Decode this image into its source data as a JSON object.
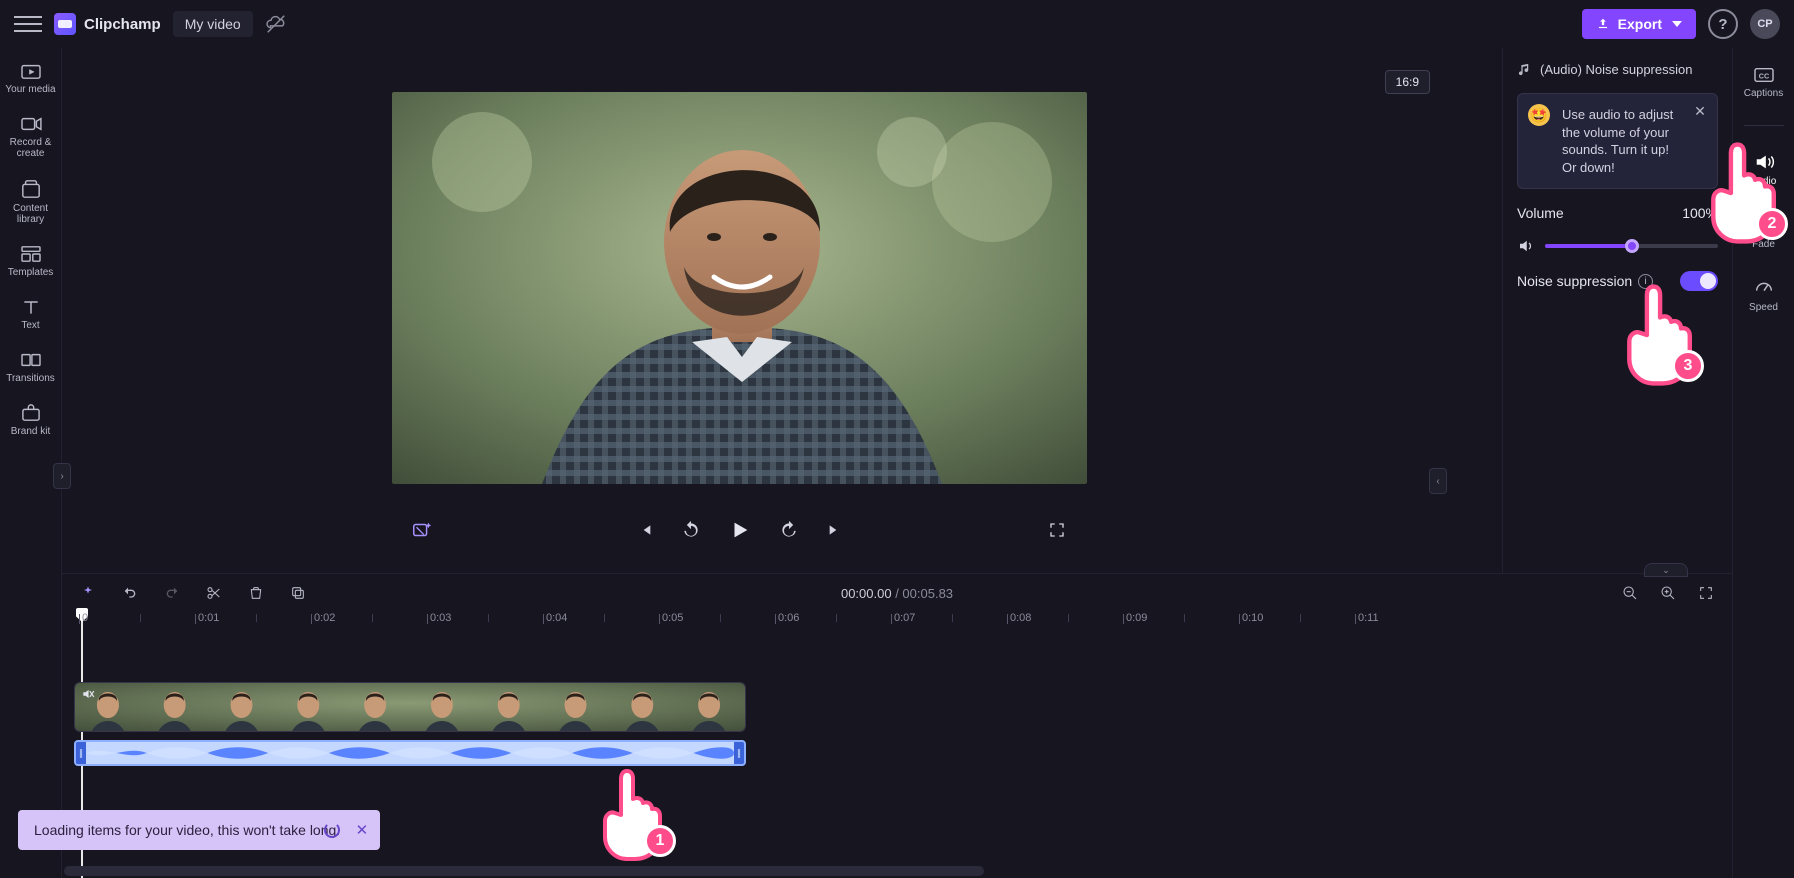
{
  "brand": "Clipchamp",
  "project_name": "My video",
  "export_label": "Export",
  "avatar_initials": "CP",
  "help_symbol": "?",
  "left_sidebar": [
    {
      "id": "media",
      "label": "Your media"
    },
    {
      "id": "record",
      "label": "Record & create"
    },
    {
      "id": "contentlib",
      "label": "Content library"
    },
    {
      "id": "templates",
      "label": "Templates"
    },
    {
      "id": "text",
      "label": "Text"
    },
    {
      "id": "transitions",
      "label": "Transitions"
    },
    {
      "id": "brandkit",
      "label": "Brand kit"
    }
  ],
  "right_sidebar": [
    {
      "id": "captions",
      "label": "Captions"
    },
    {
      "id": "audio",
      "label": "Audio"
    },
    {
      "id": "fade",
      "label": "Fade"
    },
    {
      "id": "speed",
      "label": "Speed"
    }
  ],
  "right_sidebar_active": "audio",
  "aspect_ratio": "16:9",
  "props": {
    "title": "(Audio) Noise suppression",
    "tip_text": "Use audio to adjust the volume of your sounds. Turn it up! Or down!",
    "volume_label": "Volume",
    "volume_value": "100%",
    "volume_percent": 50,
    "noise_label": "Noise suppression",
    "noise_on": true
  },
  "timeline": {
    "current": "00:00.00",
    "separator": " / ",
    "duration": "00:05.83",
    "ticks": [
      "0",
      "0:01",
      "0:02",
      "0:03",
      "0:04",
      "0:05",
      "0:06",
      "0:07",
      "0:08",
      "0:09",
      "0:10",
      "0:11"
    ],
    "tick_spacing_px": 116
  },
  "toast": {
    "text": "Loading items for your video, this won't take long."
  },
  "callouts": {
    "c1": "1",
    "c2": "2",
    "c3": "3"
  }
}
